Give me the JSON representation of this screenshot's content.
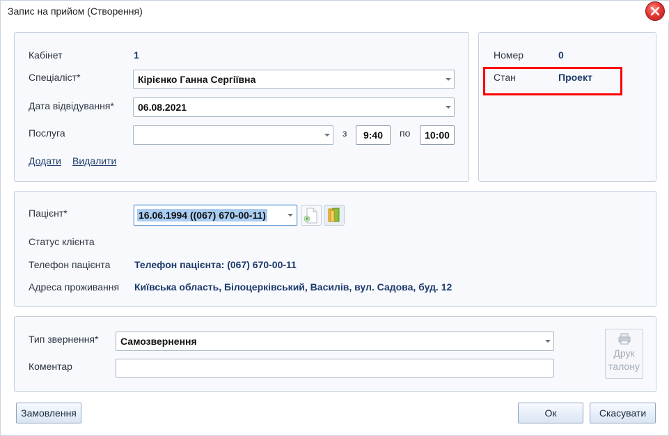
{
  "window": {
    "title": "Запис на прийом (Створення)"
  },
  "appointment": {
    "cabinet_label": "Кабінет",
    "cabinet_value": "1",
    "specialist_label": "Спеціаліст*",
    "specialist_value": "Кірієнко Ганна Сергіївна",
    "date_label": "Дата відвідування*",
    "date_value": "06.08.2021",
    "service_label": "Послуга",
    "service_value": "",
    "from_label": "з",
    "from_time": "9:40",
    "to_label": "по",
    "to_time": "10:00",
    "add_link": "Додати",
    "remove_link": "Видалити"
  },
  "status": {
    "number_label": "Номер",
    "number_value": "0",
    "state_label": "Стан",
    "state_value": "Проект"
  },
  "patient": {
    "patient_label": "Пацієнт*",
    "patient_value": "16.06.1994 ((067) 670-00-11)",
    "client_status_label": "Статус клієнта",
    "client_status_value": "",
    "phone_label": "Телефон пацієнта",
    "phone_value": "Телефон пацієнта: (067) 670-00-11",
    "address_label": "Адреса проживання",
    "address_value": "Київська область, Білоцерківський, Василів, вул. Садова, буд. 12"
  },
  "request": {
    "type_label": "Тип звернення*",
    "type_value": "Самозвернення",
    "comment_label": "Коментар",
    "comment_value": "",
    "print_line1": "Друк",
    "print_line2": "талону"
  },
  "footer": {
    "orders_button": "Замовлення",
    "ok_button": "Ок",
    "cancel_button": "Скасувати"
  },
  "colors": {
    "accent": "#1d3a6b",
    "highlight": "#ff0000",
    "selection": "#a9cdf2"
  },
  "icons": [
    "close-icon",
    "add-document-icon",
    "folder-book-icon",
    "printer-icon",
    "chevron-down-icon"
  ]
}
